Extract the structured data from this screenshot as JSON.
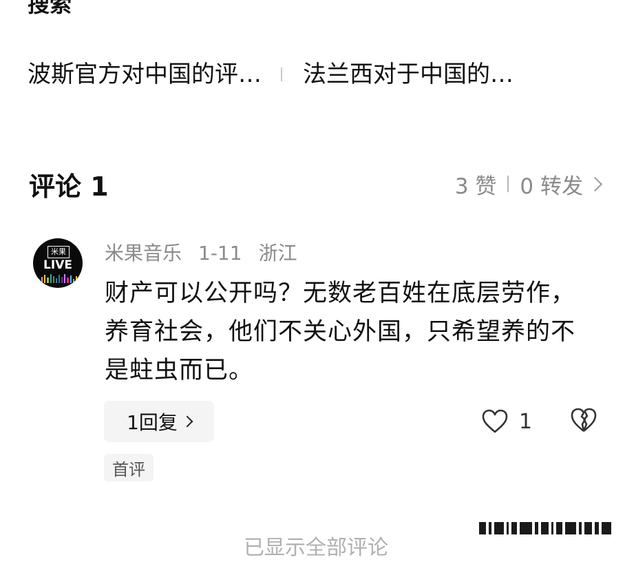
{
  "search": {
    "heading": "搜索"
  },
  "related": {
    "items": [
      {
        "label": "波斯官方对中国的评…"
      },
      {
        "label": "法兰西对于中国的…"
      }
    ]
  },
  "comments_section": {
    "title": "评论 1",
    "likes": "3 赞",
    "shares": "0 转发"
  },
  "comment": {
    "avatar_logo_top": "米果",
    "avatar_logo_live": "LIVE",
    "author": "米果音乐",
    "date": "1-11",
    "location": "浙江",
    "text": "财产可以公开吗？无数老百姓在底层劳作，养育社会，他们不关心外国，只希望养的不是蛀虫而已。",
    "reply_label": "1回复",
    "like_count": "1",
    "badge": "首评"
  },
  "footer": {
    "text": "已显示全部评论"
  },
  "icons": {
    "heart": "heart-icon",
    "broken_heart": "broken-heart-icon",
    "chevron": "chevron-right-icon"
  },
  "colors": {
    "text_primary": "#111111",
    "text_secondary": "#8a8a8a",
    "chip_bg": "#f4f4f4"
  }
}
